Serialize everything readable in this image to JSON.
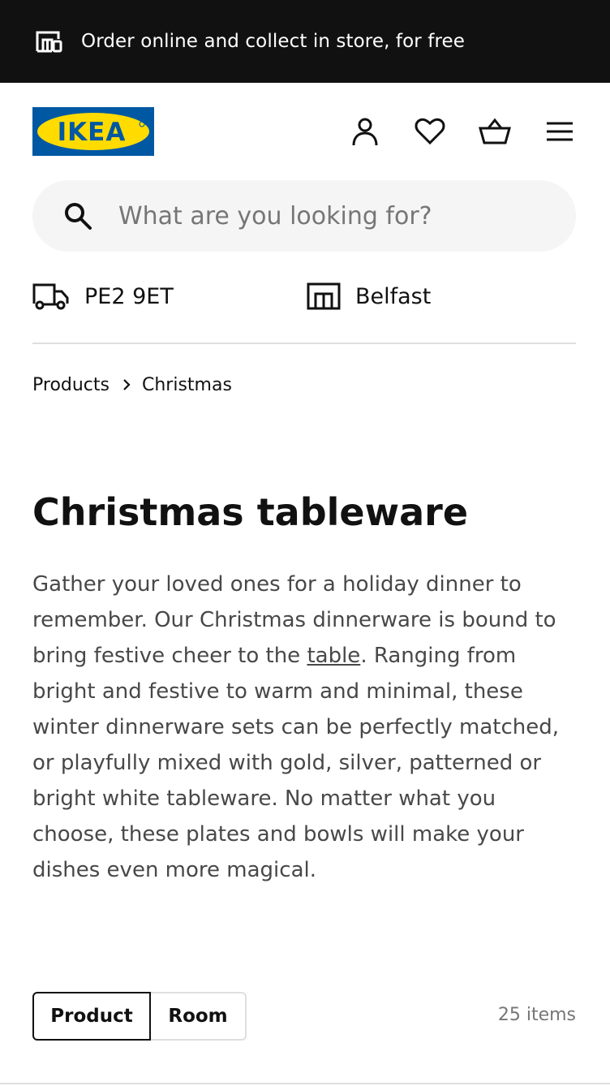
{
  "banner": {
    "icon": "store-icon",
    "text": "Order online and collect in store, for free"
  },
  "header": {
    "logo_text": "IKEA",
    "icons": [
      "user-icon",
      "heart-icon",
      "basket-icon",
      "menu-icon"
    ]
  },
  "search": {
    "placeholder": "What are you looking for?",
    "value": ""
  },
  "location": {
    "postcode": "PE2 9ET",
    "store": "Belfast"
  },
  "breadcrumb": {
    "items": [
      "Products",
      "Christmas"
    ]
  },
  "page": {
    "title": "Christmas tableware",
    "description": {
      "line1": "Gather your loved ones for a holiday dinner to",
      "line2": "remember. Our Christmas dinnerware is bound to",
      "line3_pre": "bring festive cheer to the ",
      "line3_link": "table",
      "line3_post": ". Ranging from",
      "line4": "bright and festive to warm and minimal, these",
      "line5": "winter dinnerware sets can be perfectly matched,",
      "line6": "or playfully mixed with gold, silver, patterned or",
      "line7": "bright white tableware. No matter what you",
      "line8": "choose, these plates and bowls will make your",
      "line9": "dishes even more magical."
    }
  },
  "toggle": {
    "product_label": "Product",
    "room_label": "Room"
  },
  "results": {
    "count_label": "25 items"
  },
  "colors": {
    "banner_bg": "#111111",
    "logo_blue": "#0058a3",
    "logo_yellow": "#ffdb00",
    "search_bg": "#f5f5f5"
  }
}
